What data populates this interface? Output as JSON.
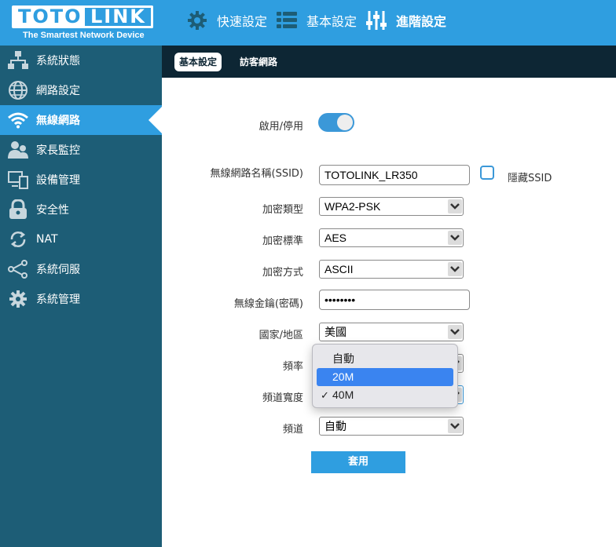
{
  "brand": {
    "logo_left": "TOTO",
    "logo_right": "LINK",
    "tagline": "The Smartest Network Device"
  },
  "topnav": {
    "quick_setup": "快速設定",
    "basic_settings": "基本設定",
    "advanced_settings": "進階設定"
  },
  "sidebar": {
    "items": [
      {
        "label": "系統狀態",
        "icon": "network-status-icon"
      },
      {
        "label": "網路設定",
        "icon": "globe-icon"
      },
      {
        "label": "無線網路",
        "icon": "wifi-icon"
      },
      {
        "label": "家長監控",
        "icon": "parental-control-icon"
      },
      {
        "label": "設備管理",
        "icon": "devices-icon"
      },
      {
        "label": "安全性",
        "icon": "lock-icon"
      },
      {
        "label": "NAT",
        "icon": "nat-icon"
      },
      {
        "label": "系統伺服",
        "icon": "share-icon"
      },
      {
        "label": "系統管理",
        "icon": "gear-icon"
      }
    ],
    "active_index": 2
  },
  "subnav": {
    "tabs": [
      "基本設定",
      "訪客網路"
    ],
    "active_index": 0
  },
  "form": {
    "enable_label": "啟用/停用",
    "enable_state": true,
    "ssid_label": "無線網路名稱(SSID)",
    "ssid_value": "TOTOLINK_LR350",
    "hide_ssid_label": "隱藏SSID",
    "hide_ssid_checked": false,
    "encryption_type_label": "加密類型",
    "encryption_type_value": "WPA2-PSK",
    "encryption_standard_label": "加密標準",
    "encryption_standard_value": "AES",
    "encryption_method_label": "加密方式",
    "encryption_method_value": "ASCII",
    "key_label": "無線金鑰(密碼)",
    "key_value": "••••••••",
    "country_label": "國家/地區",
    "country_value": "美國",
    "frequency_label": "頻率",
    "bandwidth_label": "頻道寬度",
    "channel_label": "頻道",
    "channel_value": "自動",
    "apply_label": "套用"
  },
  "dropdown": {
    "options": [
      "自動",
      "20M",
      "40M"
    ],
    "highlighted_index": 1,
    "checked_index": 2,
    "check_mark": "✓"
  },
  "colors": {
    "accent": "#2f9ee0",
    "sidebar": "#1d5d76",
    "subnav": "#0d2634",
    "toggle_on": "#3b98d8",
    "dropdown_highlight": "#3a84f0"
  }
}
